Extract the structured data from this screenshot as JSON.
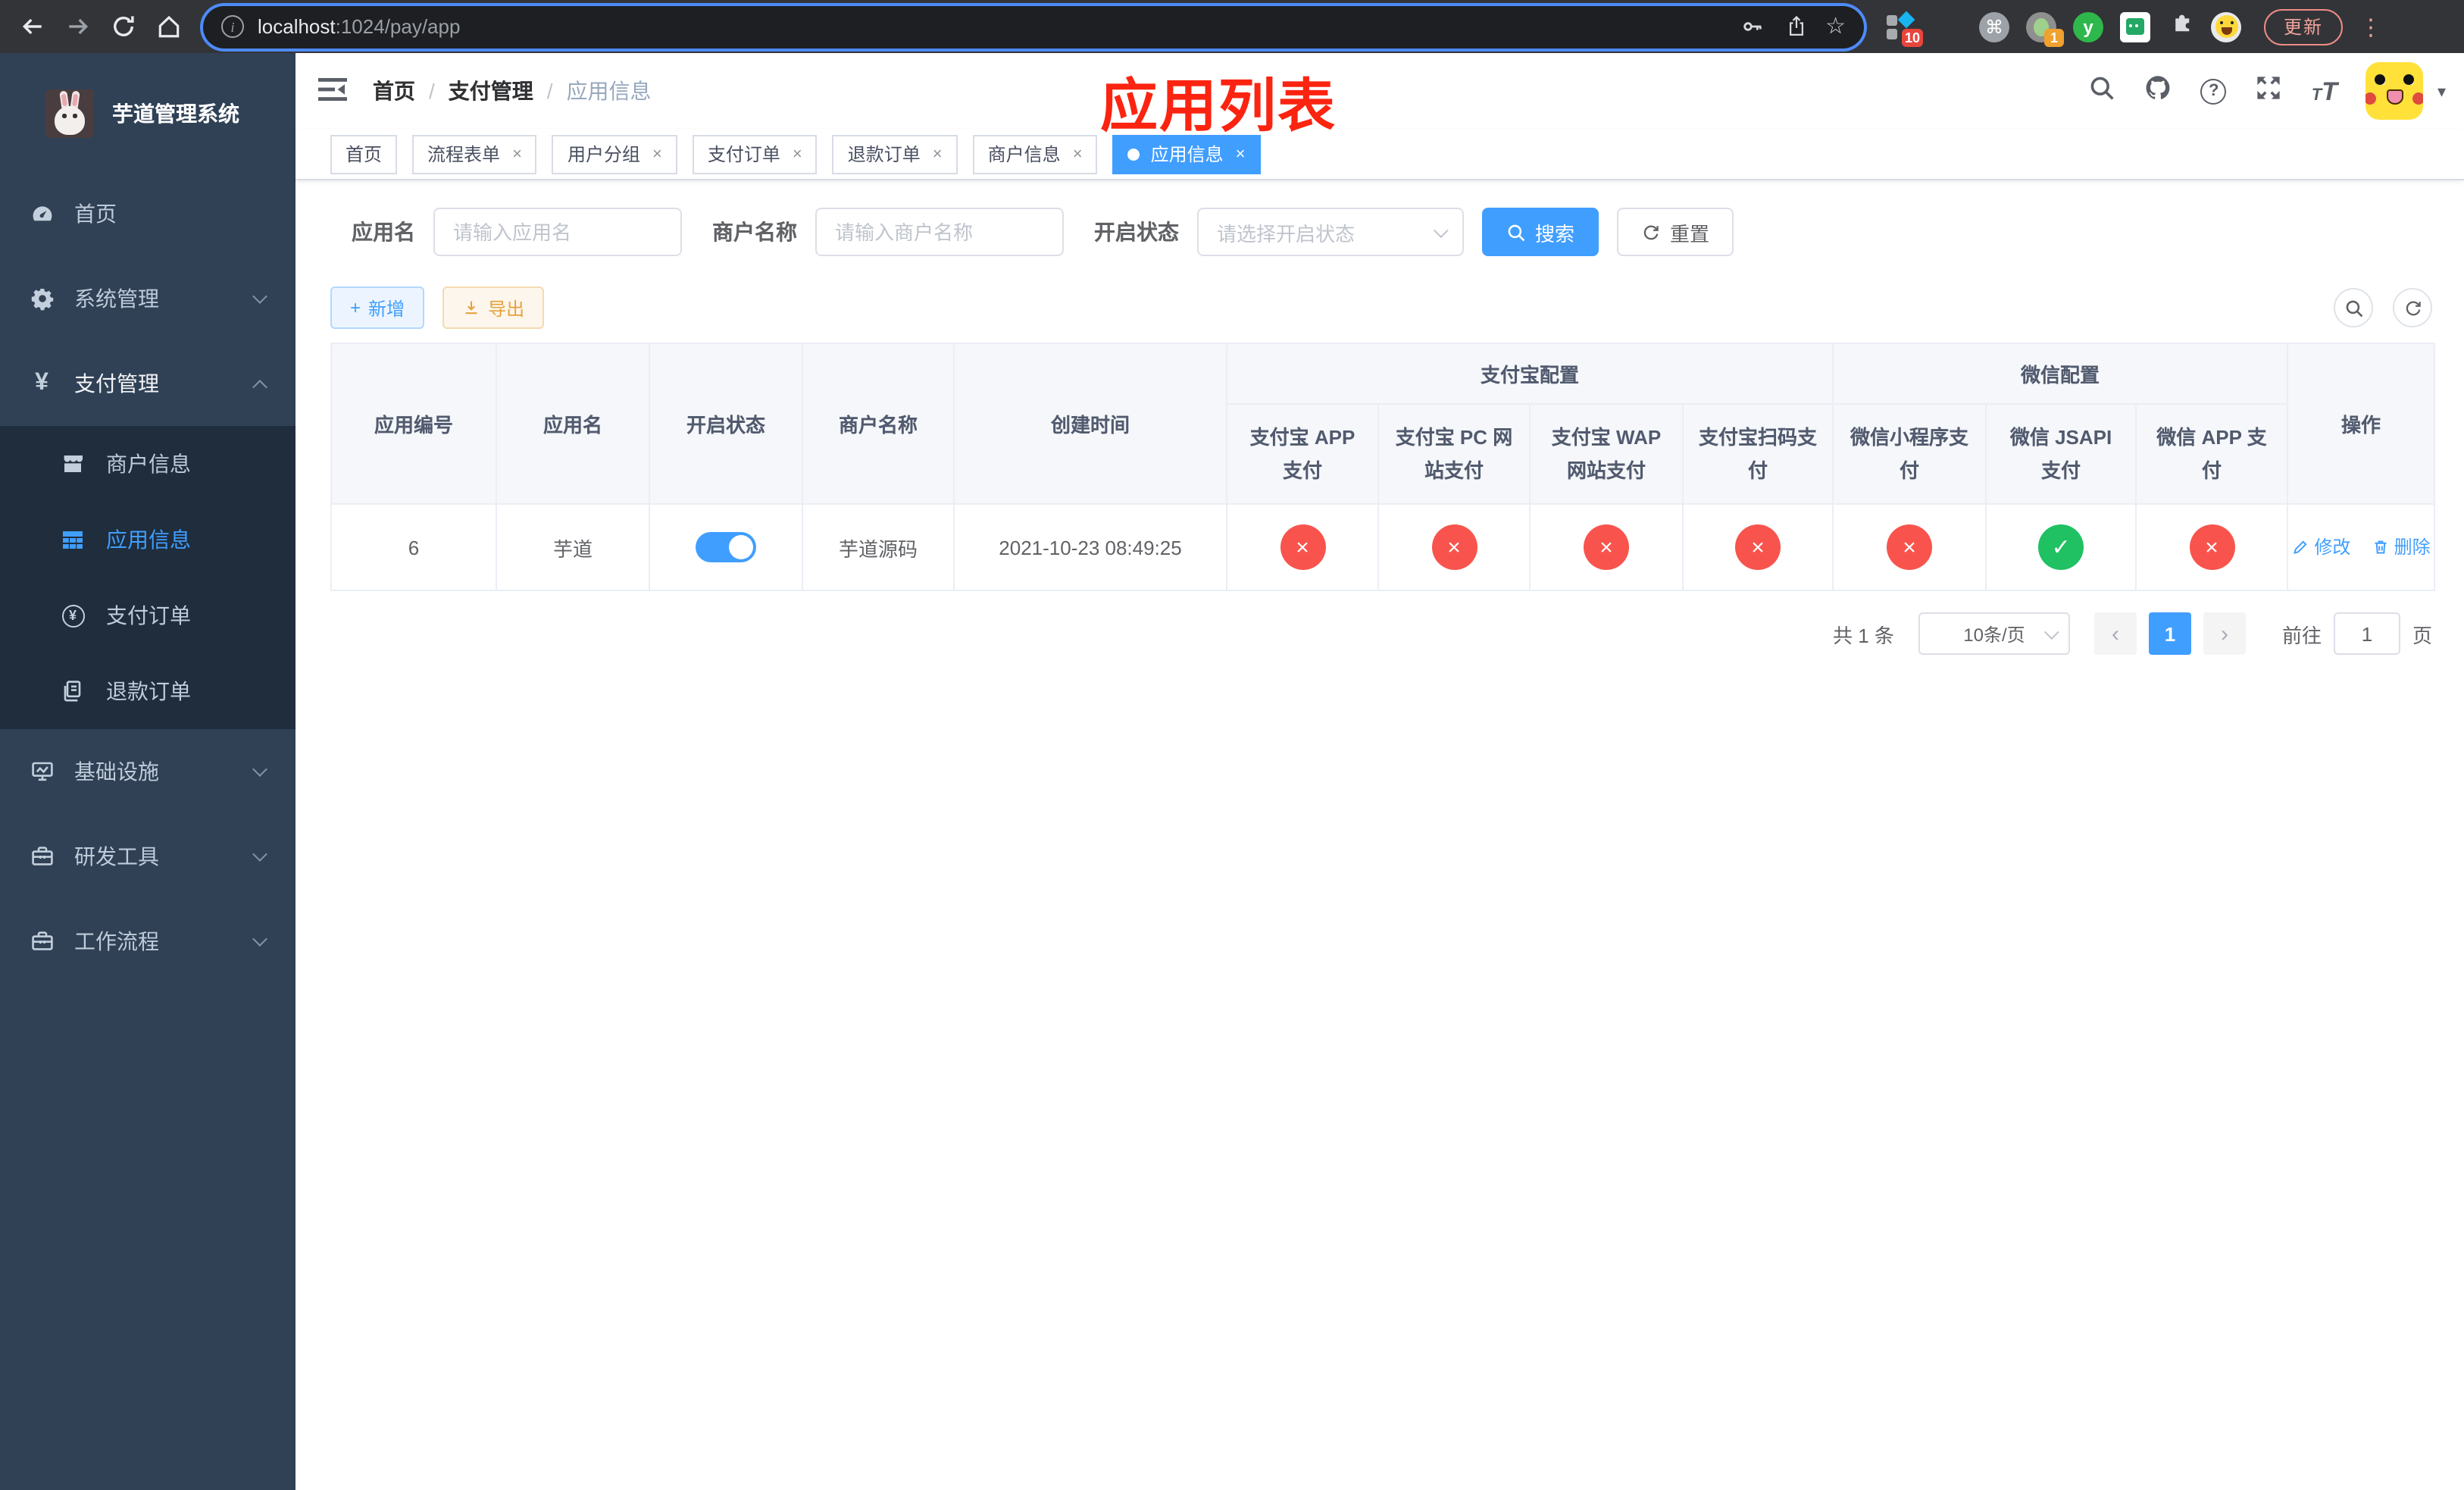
{
  "browser": {
    "url_host": "localhost",
    "url_path": ":1024/pay/app",
    "update_label": "更新",
    "ext_badge_10": "10",
    "ext_badge_1": "1",
    "ext_y_label": "y"
  },
  "icons": {
    "info_glyph": "i",
    "star_glyph": "☆",
    "command_glyph": "⌘",
    "kebab_glyph": "⋮",
    "caret_glyph": "▾",
    "question_glyph": "?",
    "font_t": "T",
    "yen_glyph": "¥",
    "check_glyph": "✓",
    "cross_glyph": "×",
    "close_glyph": "×",
    "plus_glyph": "+",
    "prev_glyph": "‹",
    "next_glyph": "›"
  },
  "sidebar": {
    "title": "芋道管理系统",
    "items": [
      {
        "label": "首页"
      },
      {
        "label": "系统管理"
      },
      {
        "label": "支付管理"
      },
      {
        "label": "商户信息"
      },
      {
        "label": "应用信息"
      },
      {
        "label": "支付订单"
      },
      {
        "label": "退款订单"
      },
      {
        "label": "基础设施"
      },
      {
        "label": "研发工具"
      },
      {
        "label": "工作流程"
      }
    ]
  },
  "navbar": {
    "breadcrumb": {
      "home": "首页",
      "section": "支付管理",
      "current": "应用信息",
      "separator": "/"
    }
  },
  "annotation": {
    "title": "应用列表"
  },
  "tabs": [
    {
      "label": "首页"
    },
    {
      "label": "流程表单"
    },
    {
      "label": "用户分组"
    },
    {
      "label": "支付订单"
    },
    {
      "label": "退款订单"
    },
    {
      "label": "商户信息"
    },
    {
      "label": "应用信息"
    }
  ],
  "filters": {
    "app_name_label": "应用名",
    "app_name_placeholder": "请输入应用名",
    "merchant_label": "商户名称",
    "merchant_placeholder": "请输入商户名称",
    "status_label": "开启状态",
    "status_placeholder": "请选择开启状态",
    "search_label": "搜索",
    "reset_label": "重置"
  },
  "toolbar": {
    "add_label": "新增",
    "export_label": "导出"
  },
  "table": {
    "columns": {
      "app_id": "应用编号",
      "app_name": "应用名",
      "status": "开启状态",
      "merchant": "商户名称",
      "create_time": "创建时间",
      "alipay_group": "支付宝配置",
      "wechat_group": "微信配置",
      "alipay_app": "支付宝 APP 支付",
      "alipay_pc": "支付宝 PC 网站支付",
      "alipay_wap": "支付宝 WAP 网站支付",
      "alipay_qr": "支付宝扫码支付",
      "wx_lite": "微信小程序支付",
      "wx_jsapi": "微信 JSAPI 支付",
      "wx_app": "微信 APP 支付",
      "actions": "操作"
    },
    "rows": [
      {
        "app_id": "6",
        "app_name": "芋道",
        "status_on": true,
        "merchant": "芋道源码",
        "create_time": "2021-10-23 08:49:25",
        "configs": {
          "alipay_app": false,
          "alipay_pc": false,
          "alipay_wap": false,
          "alipay_qr": false,
          "wx_lite": false,
          "wx_jsapi": true,
          "wx_app": false
        },
        "edit_label": "修改",
        "delete_label": "删除"
      }
    ]
  },
  "pagination": {
    "total_text": "共 1 条",
    "page_size": "10条/页",
    "page": "1",
    "goto_label": "前往",
    "goto_value": "1",
    "goto_suffix": "页"
  },
  "colors": {
    "accent": "#409eff",
    "danger": "#f8544d",
    "success": "#1fc163",
    "annotation_red": "#fb2410",
    "sidebar_bg": "#304156",
    "submenu_bg": "#1f2d3d"
  }
}
